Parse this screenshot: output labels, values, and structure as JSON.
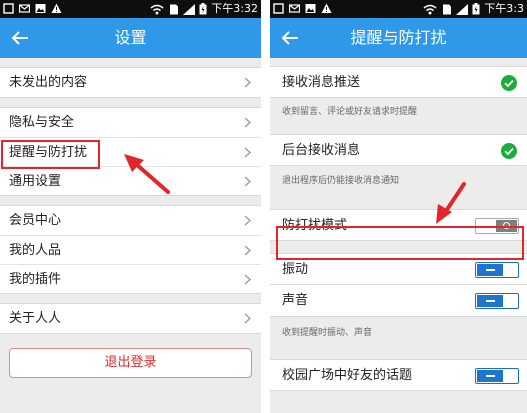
{
  "left": {
    "status": {
      "time": "下午3:32"
    },
    "title": "设置",
    "sections": [
      {
        "items": [
          "未发出的内容"
        ]
      },
      {
        "items": [
          "隐私与安全",
          "提醒与防打扰",
          "通用设置"
        ]
      },
      {
        "items": [
          "会员中心",
          "我的人品",
          "我的插件"
        ]
      },
      {
        "items": [
          "关于人人"
        ]
      }
    ],
    "logout_label": "退出登录"
  },
  "right": {
    "status": {
      "time": "下午3:3"
    },
    "title": "提醒与防打扰",
    "push_label": "接收消息推送",
    "push_desc": "收到留言、评论或好友请求时提醒",
    "background_label": "后台接收消息",
    "background_desc": "退出程序后仍能接收消息通知",
    "dnd_label": "防打扰模式",
    "vibrate_label": "振动",
    "sound_label": "声音",
    "vs_desc": "收到提醒时振动、声音",
    "campus_label": "校园广场中好友的话题"
  },
  "colors": {
    "appbar": "#2f98e8",
    "accent_blue": "#1f75cc",
    "check_green": "#1aad3b",
    "annotation_red": "#e3262b",
    "logout_red": "#e02b2b"
  }
}
